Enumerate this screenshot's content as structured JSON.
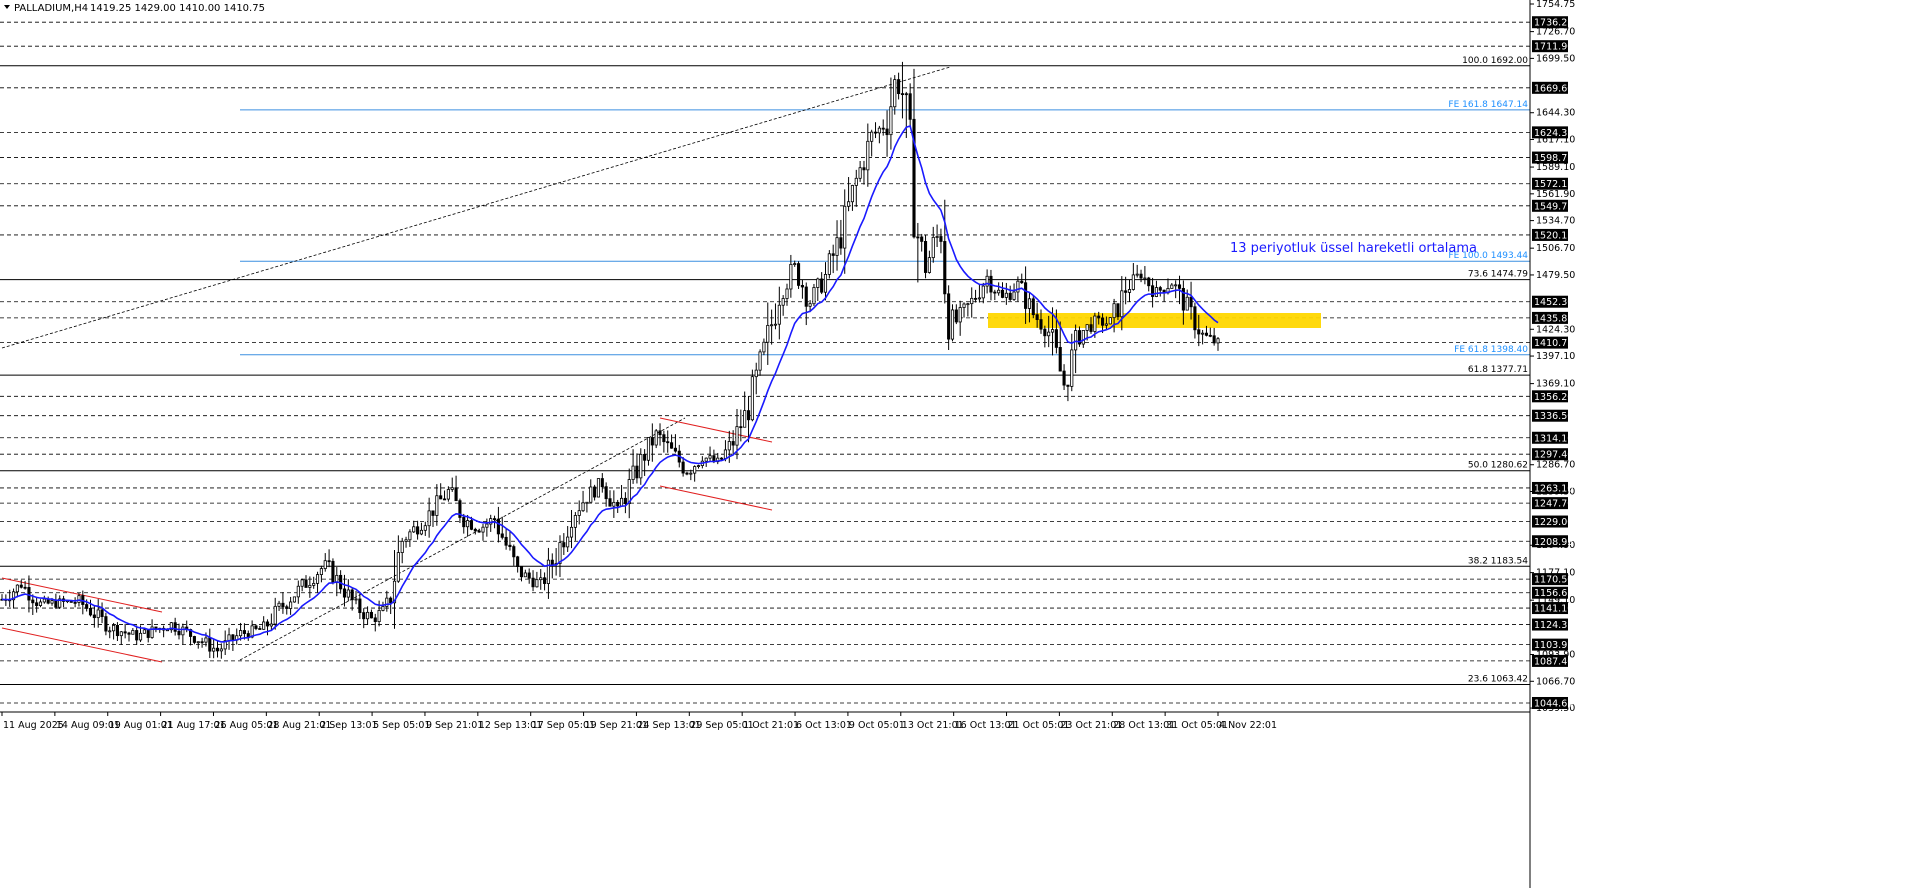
{
  "header": {
    "symbol": "PALLADIUM,H4",
    "ohlc": "1419.25 1429.00 1410.00 1410.75"
  },
  "colors": {
    "candle": "#000000",
    "ema": "#1a1aff",
    "horizontal_dashed": "#000000",
    "fibo_ret": "#000000",
    "fibo_ext": "#3c8fe0",
    "channel": "#e02020",
    "zone": "#ffd700",
    "price_label_bg": "#000000"
  },
  "chart_data": {
    "type": "candlestick",
    "title": "PALLADIUM,H4",
    "ylim": [
      1035.5,
      1754.75
    ],
    "y_ticks": [
      "1754.75",
      "1726.70",
      "1699.50",
      "1644.30",
      "1617.10",
      "1589.10",
      "1561.90",
      "1534.70",
      "1506.70",
      "1479.50",
      "1424.30",
      "1397.10",
      "1369.10",
      "1286.70",
      "1259.50",
      "1204.90",
      "1177.10",
      "1149.10",
      "1093.90",
      "1066.70",
      "1039.50"
    ],
    "horizontal_levels": [
      1736.25,
      1711.9,
      1669.6,
      1624.35,
      1598.75,
      1572.15,
      1549.75,
      1520.15,
      1452.3,
      1435.85,
      1410.75,
      1356.2,
      1336.5,
      1314.1,
      1297.4,
      1263.1,
      1247.7,
      1229.0,
      1208.95,
      1170.5,
      1156.65,
      1141.1,
      1124.35,
      1103.95,
      1087.4,
      1044.65
    ],
    "horizontal_level_labels": [
      "1736.25",
      "1711.90",
      "1669.60",
      "1624.35",
      "1598.75",
      "1572.15",
      "1549.75",
      "1520.15",
      "1452.30",
      "1435.85",
      "1410.75",
      "1356.20",
      "1336.50",
      "1314.10",
      "1297.40",
      "1263.10",
      "1247.70",
      "1229.00",
      "1208.95",
      "1170.50",
      "1156.65",
      "1141.10",
      "1124.35",
      "1103.95",
      "1087.40",
      "1044.65"
    ],
    "current_price": 1410.75,
    "fibo_retracement": [
      {
        "label": "100.0 1692.00",
        "value": 1692.0
      },
      {
        "label": "73.6 1474.79",
        "value": 1474.79
      },
      {
        "label": "61.8 1377.71",
        "value": 1377.71
      },
      {
        "label": "50.0 1280.62",
        "value": 1280.62
      },
      {
        "label": "38.2 1183.54",
        "value": 1183.54
      },
      {
        "label": "23.6 1063.42",
        "value": 1063.42
      }
    ],
    "fibo_expansion": [
      {
        "label": "FE 161.8 1647.14",
        "value": 1647.14
      },
      {
        "label": "FE 100.0 1493.44",
        "value": 1493.44
      },
      {
        "label": "FE 61.8 1398.40",
        "value": 1398.4
      }
    ],
    "x_labels": [
      "11 Aug 2025",
      "14 Aug 09:01",
      "19 Aug 01:01",
      "21 Aug 17:01",
      "26 Aug 05:01",
      "28 Aug 21:01",
      "2 Sep 13:01",
      "5 Sep 05:01",
      "9 Sep 21:01",
      "12 Sep 13:01",
      "17 Sep 05:01",
      "19 Sep 21:01",
      "24 Sep 13:01",
      "29 Sep 05:01",
      "1 Oct 21:01",
      "6 Oct 13:01",
      "9 Oct 05:01",
      "13 Oct 21:01",
      "16 Oct 13:01",
      "21 Oct 05:01",
      "23 Oct 21:01",
      "28 Oct 13:01",
      "31 Oct 05:01",
      "4 Nov 22:01"
    ],
    "price_path_anchors": [
      [
        0,
        1150
      ],
      [
        5,
        1165
      ],
      [
        10,
        1145
      ],
      [
        20,
        1148
      ],
      [
        28,
        1122
      ],
      [
        35,
        1112
      ],
      [
        44,
        1125
      ],
      [
        50,
        1112
      ],
      [
        56,
        1098
      ],
      [
        62,
        1115
      ],
      [
        68,
        1120
      ],
      [
        72,
        1140
      ],
      [
        78,
        1163
      ],
      [
        84,
        1185
      ],
      [
        88,
        1165
      ],
      [
        92,
        1142
      ],
      [
        96,
        1130
      ],
      [
        100,
        1140
      ],
      [
        104,
        1210
      ],
      [
        110,
        1232
      ],
      [
        116,
        1260
      ],
      [
        120,
        1232
      ],
      [
        124,
        1222
      ],
      [
        128,
        1232
      ],
      [
        134,
        1178
      ],
      [
        140,
        1165
      ],
      [
        144,
        1195
      ],
      [
        148,
        1235
      ],
      [
        152,
        1255
      ],
      [
        156,
        1268
      ],
      [
        160,
        1240
      ],
      [
        166,
        1290
      ],
      [
        170,
        1318
      ],
      [
        174,
        1300
      ],
      [
        178,
        1280
      ],
      [
        182,
        1295
      ],
      [
        186,
        1288
      ],
      [
        190,
        1310
      ],
      [
        194,
        1345
      ],
      [
        198,
        1400
      ],
      [
        202,
        1460
      ],
      [
        206,
        1488
      ],
      [
        210,
        1452
      ],
      [
        214,
        1478
      ],
      [
        218,
        1520
      ],
      [
        222,
        1575
      ],
      [
        226,
        1620
      ],
      [
        230,
        1635
      ],
      [
        232,
        1675
      ],
      [
        234,
        1665
      ],
      [
        236,
        1600
      ],
      [
        238,
        1520
      ],
      [
        240,
        1485
      ],
      [
        242,
        1510
      ],
      [
        244,
        1525
      ],
      [
        246,
        1440
      ],
      [
        248,
        1432
      ],
      [
        252,
        1452
      ],
      [
        256,
        1478
      ],
      [
        260,
        1455
      ],
      [
        264,
        1470
      ],
      [
        268,
        1440
      ],
      [
        272,
        1422
      ],
      [
        276,
        1368
      ],
      [
        280,
        1420
      ],
      [
        284,
        1432
      ],
      [
        288,
        1430
      ],
      [
        292,
        1465
      ],
      [
        296,
        1480
      ],
      [
        300,
        1462
      ],
      [
        304,
        1472
      ],
      [
        308,
        1446
      ],
      [
        312,
        1418
      ],
      [
        316,
        1410
      ]
    ],
    "ema_period": 13,
    "annotation": "13 periyotluk üssel hareketli ortalama",
    "grid": false,
    "legend": "none"
  }
}
